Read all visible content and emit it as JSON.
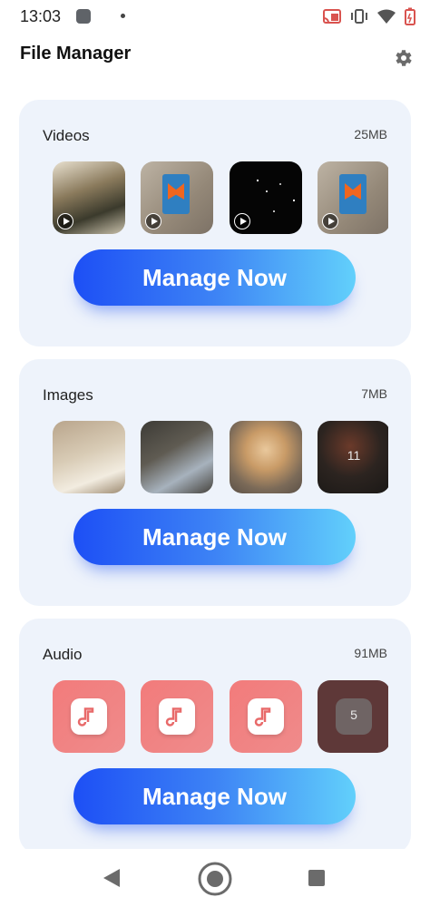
{
  "status_bar": {
    "time": "13:03"
  },
  "header": {
    "title": "File Manager",
    "settings_icon": "gear-icon"
  },
  "sections": [
    {
      "title": "Videos",
      "size": "25MB",
      "button_label": "Manage Now",
      "thumbnails": [
        "video-thumb-1",
        "video-thumb-2",
        "video-thumb-3",
        "video-thumb-4"
      ]
    },
    {
      "title": "Images",
      "size": "7MB",
      "button_label": "Manage Now",
      "thumbnails": [
        "image-thumb-1",
        "image-thumb-2",
        "image-thumb-3",
        "image-thumb-4"
      ],
      "more_count": "11"
    },
    {
      "title": "Audio",
      "size": "91MB",
      "button_label": "Manage Now",
      "thumbnails": [
        "music-note-icon",
        "music-note-icon",
        "music-note-icon",
        "music-note-icon"
      ],
      "more_count": "5"
    }
  ],
  "colors": {
    "card_bg": "#eef3fb",
    "button_start": "#1d4ff5",
    "button_end": "#62d0fb",
    "audio_tile": "#f27b7b"
  }
}
